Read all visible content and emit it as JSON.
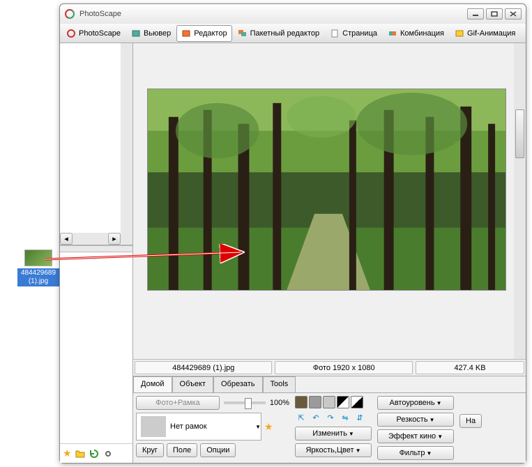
{
  "desktop_file": {
    "name": "484429689 (1).jpg"
  },
  "window": {
    "title": "PhotoScape"
  },
  "tabs": [
    {
      "label": "PhotoScape"
    },
    {
      "label": "Вьювер"
    },
    {
      "label": "Редактор"
    },
    {
      "label": "Пакетный редактор"
    },
    {
      "label": "Страница"
    },
    {
      "label": "Комбинация"
    },
    {
      "label": "Gif-Анимация"
    }
  ],
  "info": {
    "filename": "484429689 (1).jpg",
    "dimensions": "Фото 1920 x 1080",
    "size": "427.4 KB"
  },
  "subtabs": {
    "home": "Домой",
    "object": "Объект",
    "crop": "Обрезать",
    "tools": "Tools"
  },
  "controls": {
    "foto_frame": "Фото+Рамка",
    "zoom": "100%",
    "no_frames": "Нет рамок",
    "circle": "Круг",
    "field": "Поле",
    "options": "Опции",
    "autolevel": "Автоуровень",
    "sharpness": "Резкость",
    "resize": "Изменить",
    "cinema": "Эффект кино",
    "bright_color": "Яркость,Цвет",
    "filter": "Фильтр",
    "na": "На"
  }
}
